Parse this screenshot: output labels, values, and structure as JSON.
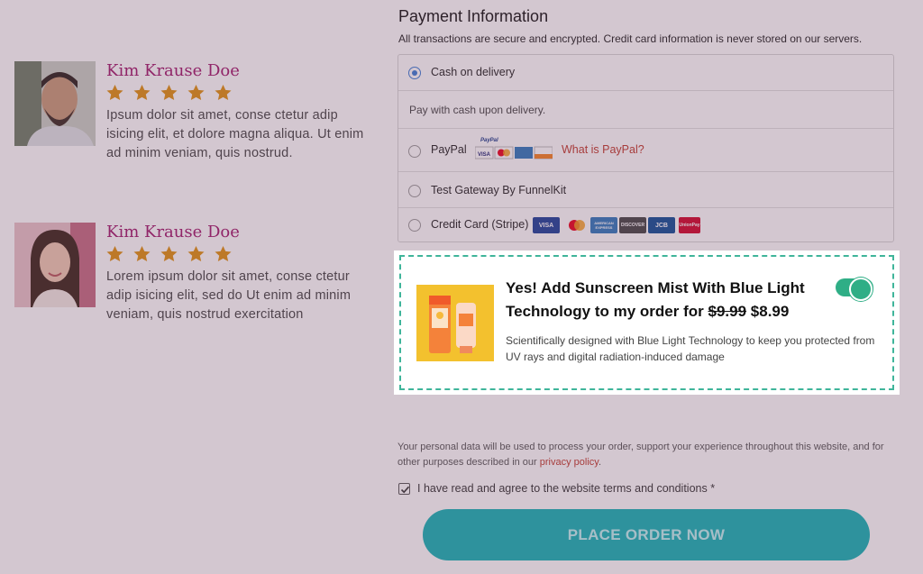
{
  "reviews": [
    {
      "name": "Kim Krause Doe",
      "rating": 5,
      "text": "Ipsum dolor sit amet, conse ctetur adip isicing elit, et dolore magna aliqua. Ut enim ad minim veniam, quis nostrud."
    },
    {
      "name": "Kim Krause Doe",
      "rating": 5,
      "text": "Lorem ipsum dolor sit amet, conse ctetur adip isicing elit, sed do Ut enim ad minim veniam, quis nostrud exercitation"
    }
  ],
  "payment": {
    "title": "Payment Information",
    "subtitle": "All transactions are secure and encrypted. Credit card information is never stored on our servers.",
    "methods": {
      "cod": {
        "label": "Cash on delivery",
        "selected": true,
        "description": "Pay with cash upon delivery."
      },
      "paypal": {
        "label": "PayPal",
        "link": "What is PayPal?",
        "badge_top": "PayPal"
      },
      "test_gateway": {
        "label": "Test Gateway By FunnelKit"
      },
      "stripe": {
        "label": "Credit Card (Stripe)"
      }
    },
    "card_brands": {
      "visa": "VISA",
      "discover": "DISCOVER",
      "jcb": "JCB",
      "unionpay": "UnionPay",
      "amex": "AMERICAN EXPRESS"
    }
  },
  "order_bump": {
    "title_prefix": "Yes! Add Sunscreen Mist With Blue Light Technology to my order for",
    "old_price": "$9.99",
    "new_price": "$8.99",
    "description": "Scientifically designed with Blue Light Technology to keep you protected from UV rays and digital radiation-induced damage",
    "enabled": true
  },
  "footer": {
    "privacy_text": "Your personal data will be used to process your order, support your experience throughout this website, and for other purposes described in our",
    "privacy_link": "privacy policy",
    "privacy_end": ".",
    "terms_label": "I have read and agree to the website terms and conditions *",
    "terms_checked": true,
    "place_order": "PLACE ORDER NOW"
  },
  "colors": {
    "accent_teal": "#14b3b6",
    "toggle_green": "#2fae86",
    "reviewer_name": "#a0176a",
    "star": "#e0900f",
    "link_red": "#c0392b"
  }
}
